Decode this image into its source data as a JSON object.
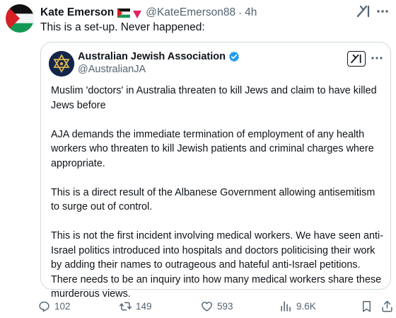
{
  "post": {
    "author_name": "Kate Emerson",
    "handle": "@KateEmerson88",
    "separator": "·",
    "time": "4h",
    "text": "This is a set-up. Never happened:"
  },
  "quoted_post": {
    "author_name": "Australian Jewish Association",
    "handle": "@AustralianJA",
    "paragraphs": [
      "Muslim 'doctors' in Australia threaten to kill Jews and claim to have killed Jews before",
      "AJA demands the immediate termination of employment of any health workers who threaten to kill Jewish patients and criminal charges where appropriate.",
      "This is a direct result of the Albanese Government allowing antisemitism to surge out of control.",
      "This is not the first incident involving medical workers. We have seen anti-Israel politics introduced into hospitals and doctors politicising their work by adding their names to outrageous and hateful anti-Israel petitions. There needs to be an inquiry into how many medical workers share these murderous views."
    ]
  },
  "actions": {
    "replies": "102",
    "reposts": "149",
    "likes": "593",
    "views": "9.6K"
  },
  "icons": {
    "avatar": "palestinian-flag-avatar",
    "flag": "palestinian-flag-emoji",
    "triangle": "red-triangle-emoji",
    "grok": "grok-icon",
    "more": "more-icon",
    "verified": "verified-badge-icon",
    "reply": "reply-icon",
    "repost": "repost-icon",
    "like": "heart-icon",
    "views": "views-icon",
    "bookmark": "bookmark-icon",
    "share": "share-icon"
  },
  "colors": {
    "text_primary": "#0f1419",
    "text_secondary": "#536471",
    "border": "#cfd9de",
    "verified_blue": "#1d9bf0",
    "quote_avatar_bg": "#14254a",
    "flag_red": "#d71f26",
    "flag_green": "#149954"
  }
}
